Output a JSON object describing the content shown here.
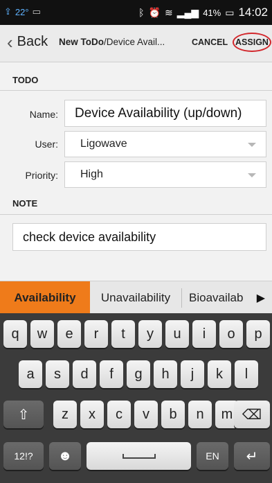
{
  "status": {
    "temp": "22°",
    "battery": "41%",
    "time": "14:02"
  },
  "actionbar": {
    "back_label": "Back",
    "crumb_title": "New ToDo",
    "crumb_sep": "/",
    "crumb_sub": "Device Avail...",
    "cancel_label": "CANCEL",
    "assign_label": "ASSIGN"
  },
  "todo": {
    "section_label": "TODO",
    "name_label": "Name:",
    "name_value": "Device Availability (up/down)",
    "user_label": "User:",
    "user_value": "Ligowave",
    "priority_label": "Priority:",
    "priority_value": "High"
  },
  "note": {
    "section_label": "NOTE",
    "value": "check device availability"
  },
  "suggestions": [
    "Availability",
    "Unavailability",
    "Bioavailab"
  ],
  "keyboard": {
    "row1": [
      "q",
      "w",
      "e",
      "r",
      "t",
      "y",
      "u",
      "i",
      "o",
      "p"
    ],
    "row2": [
      "a",
      "s",
      "d",
      "f",
      "g",
      "h",
      "j",
      "k",
      "l"
    ],
    "row3": [
      "z",
      "x",
      "c",
      "v",
      "b",
      "n",
      "m"
    ],
    "symbols_label": "12!?",
    "lang_label": "EN"
  }
}
